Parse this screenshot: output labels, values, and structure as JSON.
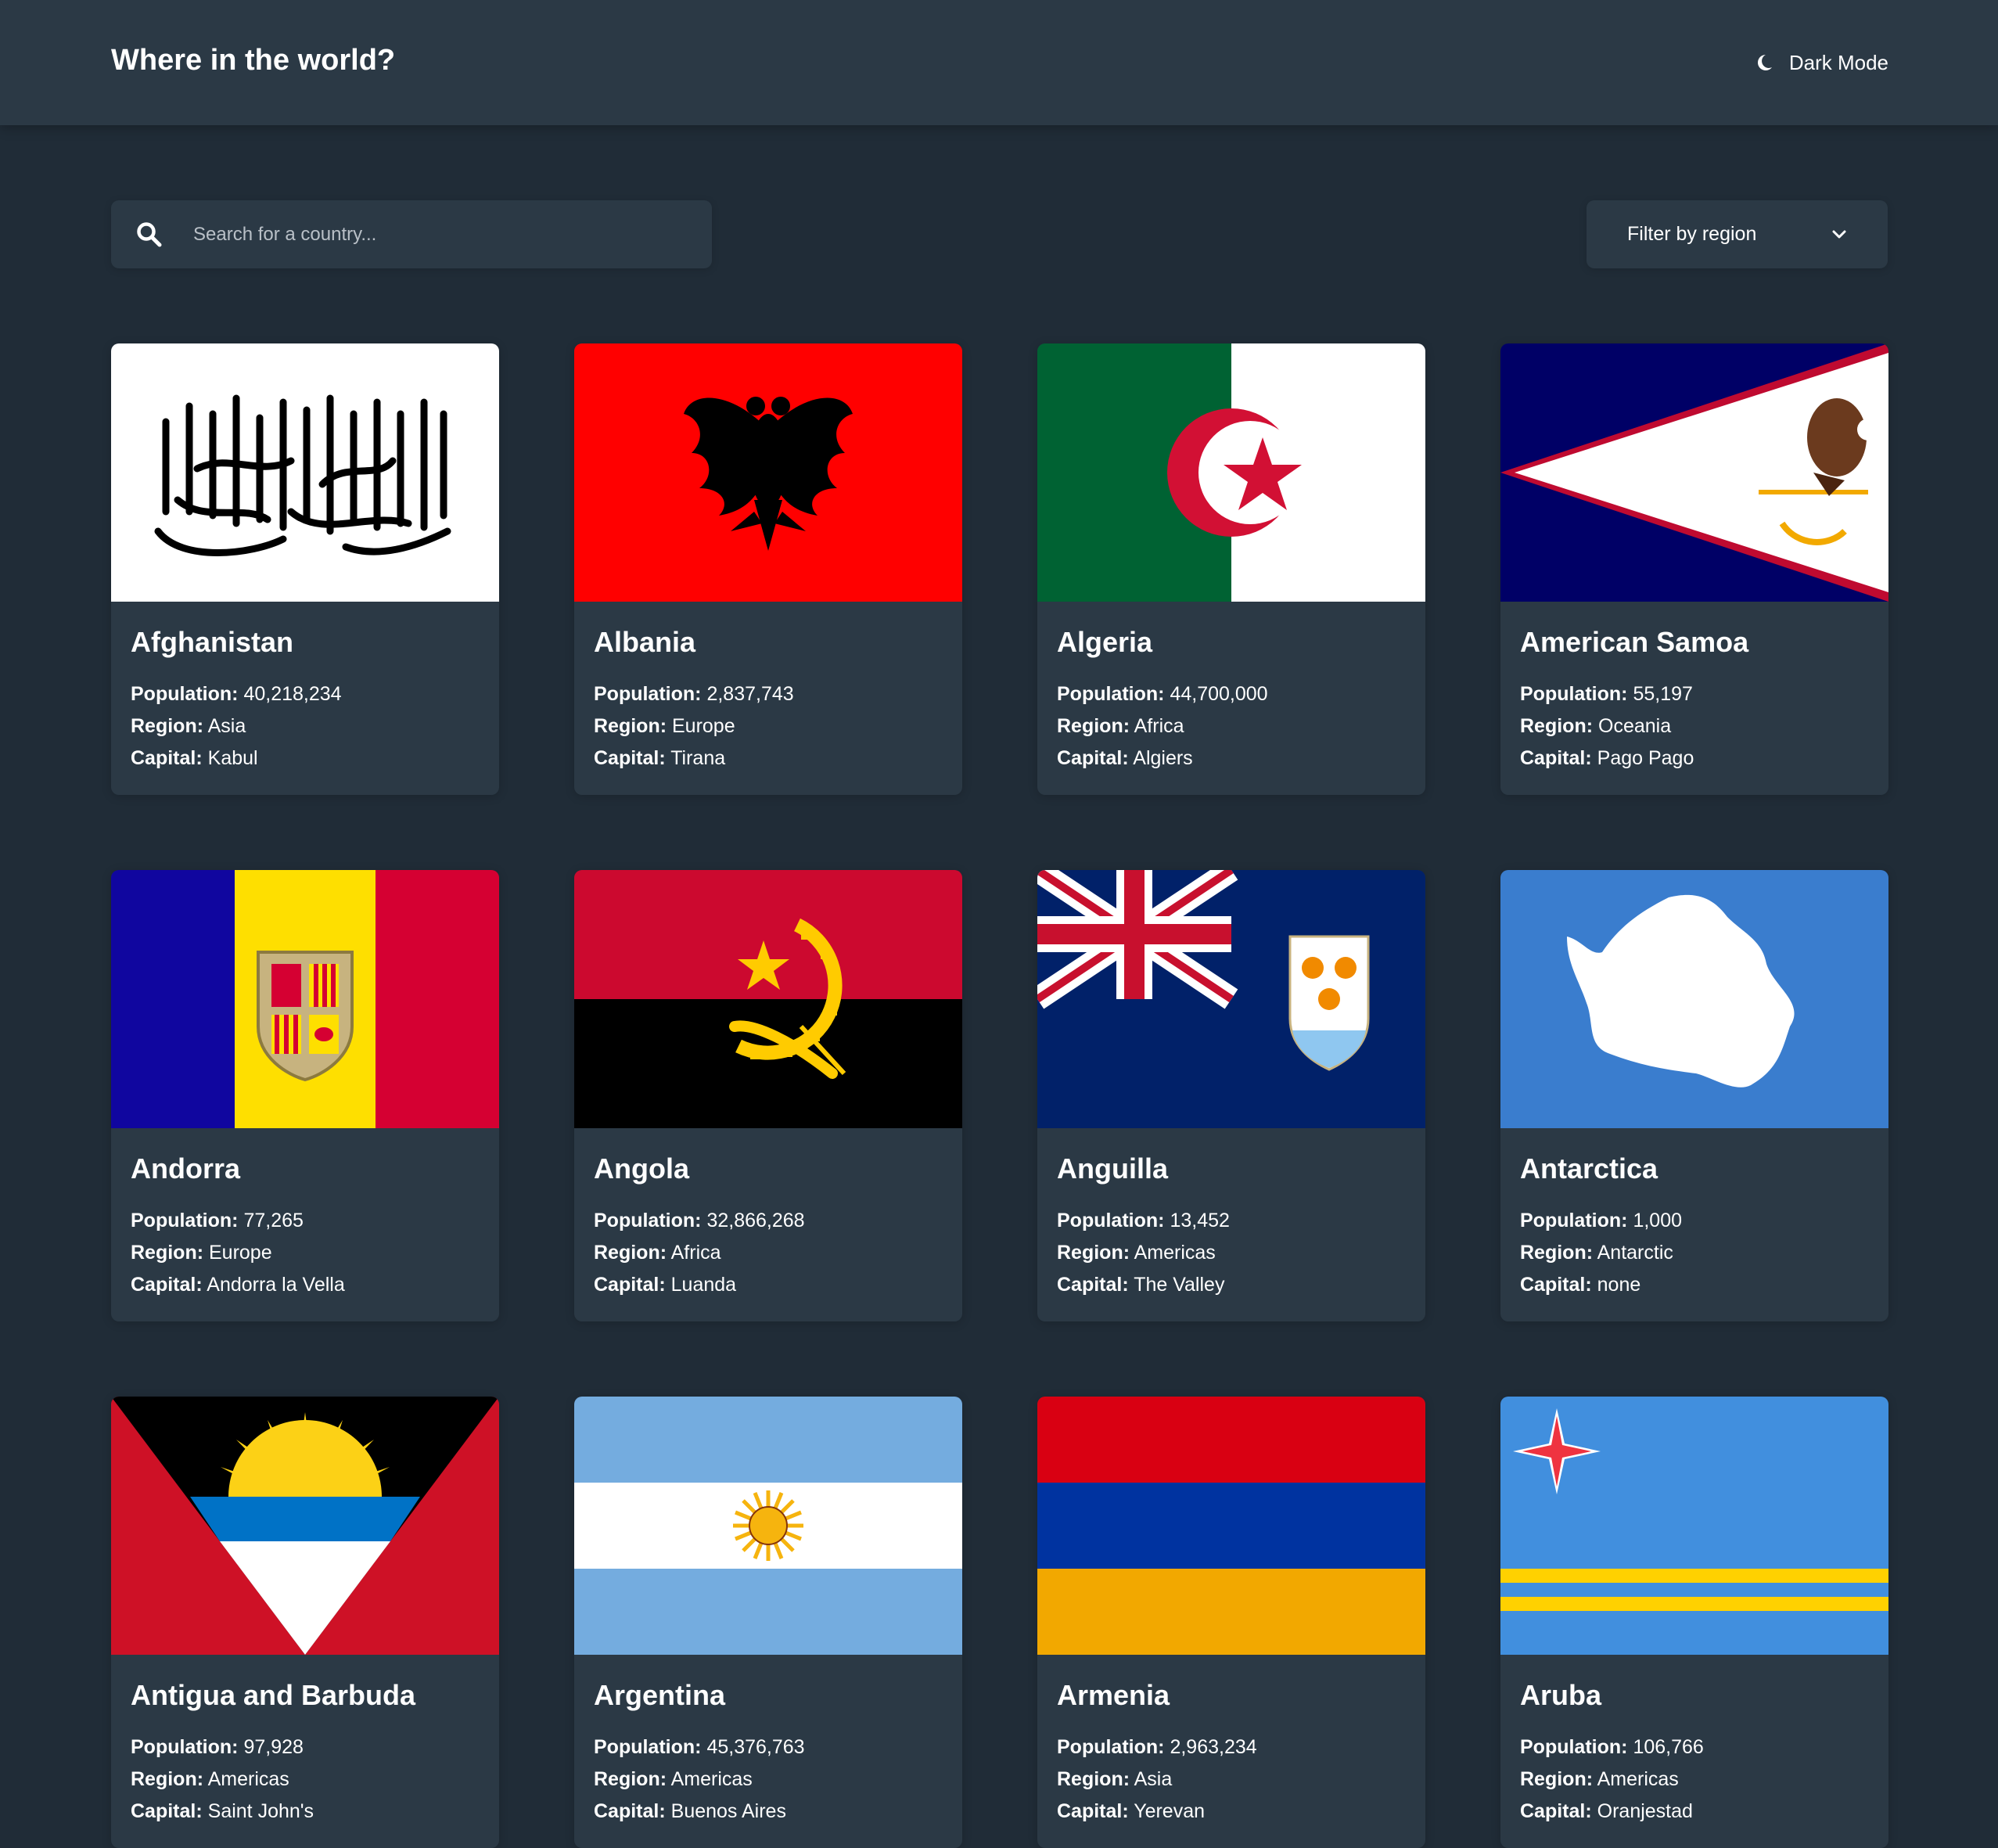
{
  "header": {
    "title": "Where in the world?",
    "theme_label": "Dark Mode"
  },
  "search": {
    "placeholder": "Search for a country..."
  },
  "filter": {
    "label": "Filter by region"
  },
  "stat_labels": {
    "population": "Population:",
    "region": "Region:",
    "capital": "Capital:"
  },
  "countries": [
    {
      "name": "Afghanistan",
      "population": "40,218,234",
      "region": "Asia",
      "capital": "Kabul",
      "flag": "afghanistan-flag"
    },
    {
      "name": "Albania",
      "population": "2,837,743",
      "region": "Europe",
      "capital": "Tirana",
      "flag": "albania-flag"
    },
    {
      "name": "Algeria",
      "population": "44,700,000",
      "region": "Africa",
      "capital": "Algiers",
      "flag": "algeria-flag"
    },
    {
      "name": "American Samoa",
      "population": "55,197",
      "region": "Oceania",
      "capital": "Pago Pago",
      "flag": "american-samoa-flag"
    },
    {
      "name": "Andorra",
      "population": "77,265",
      "region": "Europe",
      "capital": "Andorra la Vella",
      "flag": "andorra-flag"
    },
    {
      "name": "Angola",
      "population": "32,866,268",
      "region": "Africa",
      "capital": "Luanda",
      "flag": "angola-flag"
    },
    {
      "name": "Anguilla",
      "population": "13,452",
      "region": "Americas",
      "capital": "The Valley",
      "flag": "anguilla-flag"
    },
    {
      "name": "Antarctica",
      "population": "1,000",
      "region": "Antarctic",
      "capital": "none",
      "flag": "antarctica-flag"
    },
    {
      "name": "Antigua and Barbuda",
      "population": "97,928",
      "region": "Americas",
      "capital": "Saint John's",
      "flag": "antigua-flag"
    },
    {
      "name": "Argentina",
      "population": "45,376,763",
      "region": "Americas",
      "capital": "Buenos Aires",
      "flag": "argentina-flag"
    },
    {
      "name": "Armenia",
      "population": "2,963,234",
      "region": "Asia",
      "capital": "Yerevan",
      "flag": "armenia-flag"
    },
    {
      "name": "Aruba",
      "population": "106,766",
      "region": "Americas",
      "capital": "Oranjestad",
      "flag": "aruba-flag"
    }
  ],
  "colors": {
    "background": "#202c37",
    "element": "#2b3945",
    "text": "#ffffff"
  }
}
